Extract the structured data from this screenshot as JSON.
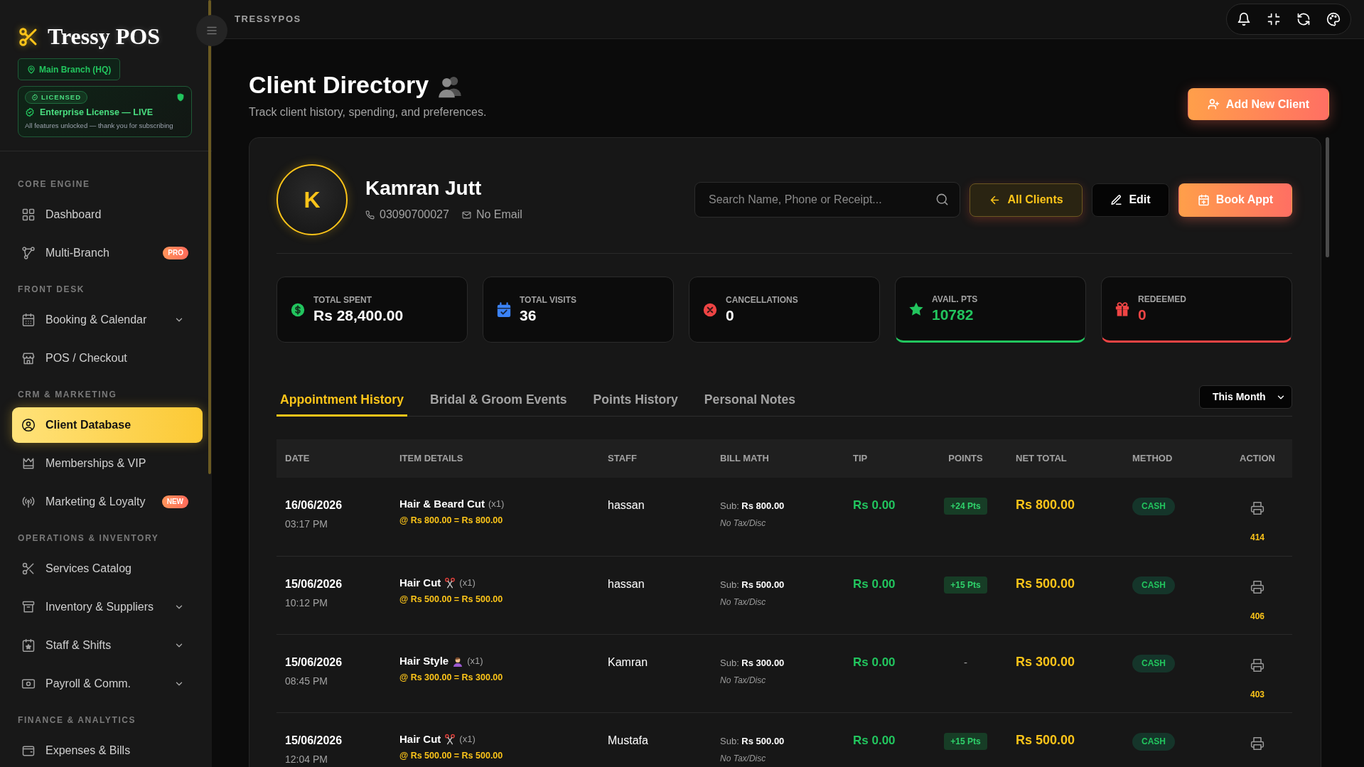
{
  "sidebar": {
    "brand": "Tressy POS",
    "branch": "Main Branch (HQ)",
    "license": {
      "tag": "LICENSED",
      "title": "Enterprise License — LIVE",
      "note": "All features unlocked — thank you for subscribing"
    },
    "sections": [
      {
        "title": "CORE ENGINE",
        "items": [
          {
            "label": "Dashboard",
            "selected": false,
            "expandable": false
          },
          {
            "label": "Multi-Branch",
            "selected": false,
            "expandable": false,
            "badge": "PRO"
          }
        ]
      },
      {
        "title": "FRONT DESK",
        "items": [
          {
            "label": "Booking & Calendar",
            "selected": false,
            "expandable": true
          },
          {
            "label": "POS / Checkout",
            "selected": false,
            "expandable": false
          }
        ]
      },
      {
        "title": "CRM & MARKETING",
        "items": [
          {
            "label": "Client Database",
            "selected": true,
            "expandable": false
          },
          {
            "label": "Memberships & VIP",
            "selected": false,
            "expandable": false
          },
          {
            "label": "Marketing & Loyalty",
            "selected": false,
            "expandable": false,
            "badge": "NEW"
          }
        ]
      },
      {
        "title": "OPERATIONS & INVENTORY",
        "items": [
          {
            "label": "Services Catalog",
            "selected": false,
            "expandable": false
          },
          {
            "label": "Inventory & Suppliers",
            "selected": false,
            "expandable": true
          },
          {
            "label": "Staff & Shifts",
            "selected": false,
            "expandable": true
          },
          {
            "label": "Payroll & Comm.",
            "selected": false,
            "expandable": true
          }
        ]
      },
      {
        "title": "FINANCE & ANALYTICS",
        "items": [
          {
            "label": "Expenses & Bills",
            "selected": false,
            "expandable": false
          }
        ]
      }
    ]
  },
  "header": {
    "app_label": "TRESSYPOS"
  },
  "page": {
    "title": "Client Directory",
    "subtitle": "Track client history, spending, and preferences.",
    "add_button": "Add New Client"
  },
  "client": {
    "initial": "K",
    "name": "Kamran Jutt",
    "phone": "03090700027",
    "email": "No Email"
  },
  "search": {
    "placeholder": "Search Name, Phone or Receipt..."
  },
  "actions": [
    {
      "kind": "back",
      "label": "All Clients"
    },
    {
      "kind": "edit",
      "label": "Edit"
    },
    {
      "kind": "book",
      "label": "Book Appt"
    }
  ],
  "stats": [
    {
      "label": "TOTAL SPENT",
      "value": "Rs 28,400.00",
      "color": "#22c55e",
      "accent": false
    },
    {
      "label": "TOTAL VISITS",
      "value": "36",
      "color": "#3b82f6",
      "accent": false
    },
    {
      "label": "CANCELLATIONS",
      "value": "0",
      "color": "#ef4444",
      "accent": false
    },
    {
      "label": "AVAIL. PTS",
      "value": "10782",
      "color": "#22c55e",
      "accent": true
    },
    {
      "label": "REDEEMED",
      "value": "0",
      "color": "#ef4444",
      "accent": true
    }
  ],
  "tabs": [
    {
      "label": "Appointment History",
      "selected": true
    },
    {
      "label": "Bridal & Groom Events",
      "selected": false
    },
    {
      "label": "Points History",
      "selected": false
    },
    {
      "label": "Personal Notes",
      "selected": false
    }
  ],
  "period_filter": {
    "value": "This Month"
  },
  "table": {
    "columns": [
      "DATE",
      "ITEM DETAILS",
      "STAFF",
      "BILL MATH",
      "TIP",
      "POINTS",
      "NET TOTAL",
      "METHOD",
      "ACTION"
    ],
    "rows": [
      {
        "date": "16/06/2026",
        "time": "03:17 PM",
        "item": {
          "kind": "plain",
          "name": "Hair & Beard Cut",
          "qty": "(x1)",
          "calc": "@ Rs 800.00 = Rs 800.00"
        },
        "staff": "hassan",
        "bill": "Sub: **Rs 800.00**",
        "bill_note": "No Tax/Disc",
        "tip": "Rs 0.00",
        "points": {
          "kind": "badge",
          "text": "+24 Pts"
        },
        "net": "Rs 800.00",
        "method": "CASH",
        "receipt": "414"
      },
      {
        "date": "15/06/2026",
        "time": "10:12 PM",
        "item": {
          "kind": "scissors",
          "name": "Hair Cut",
          "qty": "(x1)",
          "calc": "@ Rs 500.00 = Rs 500.00"
        },
        "staff": "hassan",
        "bill": "Sub: **Rs 500.00**",
        "bill_note": "No Tax/Disc",
        "tip": "Rs 0.00",
        "points": {
          "kind": "badge",
          "text": "+15 Pts"
        },
        "net": "Rs 500.00",
        "method": "CASH",
        "receipt": "406"
      },
      {
        "date": "15/06/2026",
        "time": "08:45 PM",
        "item": {
          "kind": "hairstyle",
          "name": "Hair Style",
          "qty": "(x1)",
          "calc": "@ Rs 300.00 = Rs 300.00"
        },
        "staff": "Kamran",
        "bill": "Sub: **Rs 300.00**",
        "bill_note": "No Tax/Disc",
        "tip": "Rs 0.00",
        "points": {
          "kind": "plain",
          "text": "-"
        },
        "net": "Rs 300.00",
        "method": "CASH",
        "receipt": "403"
      },
      {
        "date": "15/06/2026",
        "time": "12:04 PM",
        "item": {
          "kind": "scissors",
          "name": "Hair Cut",
          "qty": "(x1)",
          "calc": "@ Rs 500.00 = Rs 500.00"
        },
        "staff": "Mustafa",
        "bill": "Sub: **Rs 500.00**",
        "bill_note": "No Tax/Disc",
        "tip": "Rs 0.00",
        "points": {
          "kind": "badge",
          "text": "+15 Pts"
        },
        "net": "Rs 500.00",
        "method": "CASH"
      }
    ]
  }
}
